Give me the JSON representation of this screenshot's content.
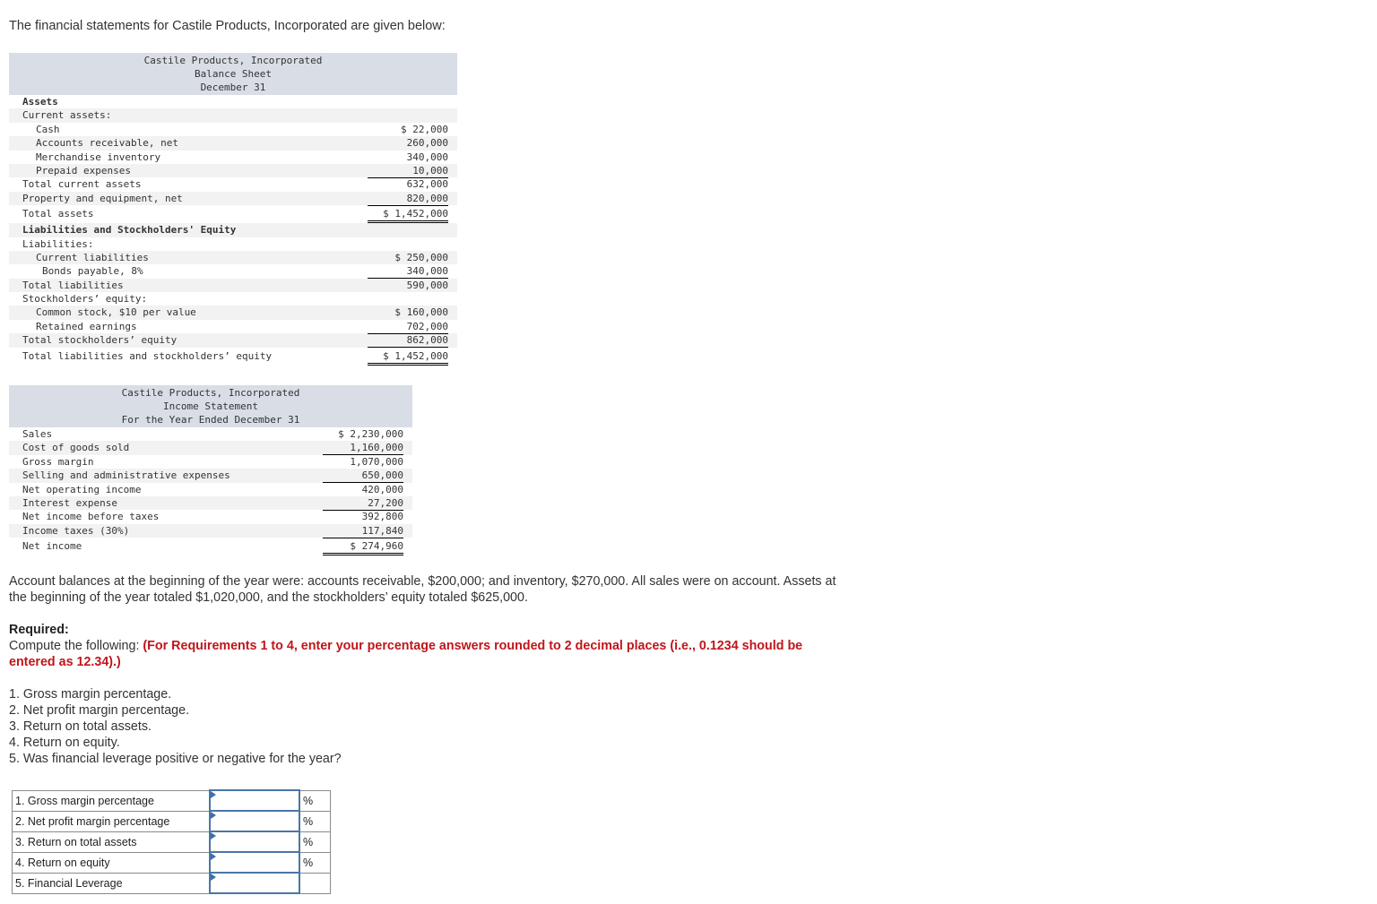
{
  "intro": "The financial statements for Castile Products, Incorporated are given below:",
  "balance_sheet": {
    "header": [
      "Castile Products, Incorporated",
      "Balance Sheet",
      "December 31"
    ],
    "rows": [
      {
        "label": "Assets",
        "value": "",
        "style": "b",
        "indent": 0,
        "line": ""
      },
      {
        "label": "Current assets:",
        "value": "",
        "indent": 0,
        "line": ""
      },
      {
        "label": "Cash",
        "value": "$ 22,000",
        "indent": 1,
        "line": ""
      },
      {
        "label": "Accounts receivable, net",
        "value": "260,000",
        "indent": 1,
        "line": ""
      },
      {
        "label": "Merchandise inventory",
        "value": "340,000",
        "indent": 1,
        "line": ""
      },
      {
        "label": "Prepaid expenses",
        "value": "10,000",
        "indent": 1,
        "line": "ul"
      },
      {
        "label": "Total current assets",
        "value": "632,000",
        "indent": 0,
        "line": ""
      },
      {
        "label": "Property and equipment, net",
        "value": "820,000",
        "indent": 0,
        "line": "ul"
      },
      {
        "label": "Total assets",
        "value": "$ 1,452,000",
        "indent": 0,
        "line": "dul",
        "tall": true
      },
      {
        "label": "Liabilities and Stockholders' Equity",
        "value": "",
        "style": "b",
        "indent": 0,
        "line": ""
      },
      {
        "label": "Liabilities:",
        "value": "",
        "indent": 0,
        "line": ""
      },
      {
        "label": "Current liabilities",
        "value": "$ 250,000",
        "indent": 1,
        "line": ""
      },
      {
        "label": "Bonds payable, 8%",
        "value": "340,000",
        "indent": 2,
        "line": "ul"
      },
      {
        "label": "Total liabilities",
        "value": "590,000",
        "indent": 0,
        "line": ""
      },
      {
        "label": "Stockholders’ equity:",
        "value": "",
        "indent": 0,
        "line": ""
      },
      {
        "label": "Common stock, $10 per value",
        "value": "$ 160,000",
        "indent": 1,
        "line": ""
      },
      {
        "label": "Retained earnings",
        "value": "702,000",
        "indent": 1,
        "line": "ul"
      },
      {
        "label": "Total stockholders’ equity",
        "value": "862,000",
        "indent": 0,
        "line": "ul"
      },
      {
        "label": "Total liabilities and stockholders’ equity",
        "value": "$ 1,452,000",
        "indent": 0,
        "line": "dul",
        "tall": true
      }
    ]
  },
  "income_statement": {
    "header": [
      "Castile Products, Incorporated",
      "Income Statement",
      "For the Year Ended December 31"
    ],
    "rows": [
      {
        "label": "Sales",
        "value": "$ 2,230,000",
        "indent": 0,
        "line": ""
      },
      {
        "label": "Cost of goods sold",
        "value": "1,160,000",
        "indent": 0,
        "line": "ul"
      },
      {
        "label": "Gross margin",
        "value": "1,070,000",
        "indent": 0,
        "line": ""
      },
      {
        "label": "Selling and administrative expenses",
        "value": "650,000",
        "indent": 0,
        "line": "ul"
      },
      {
        "label": "Net operating income",
        "value": "420,000",
        "indent": 0,
        "line": ""
      },
      {
        "label": "Interest expense",
        "value": "27,200",
        "indent": 0,
        "line": "ul"
      },
      {
        "label": "Net income before taxes",
        "value": "392,800",
        "indent": 0,
        "line": ""
      },
      {
        "label": "Income taxes (30%)",
        "value": "117,840",
        "indent": 0,
        "line": "ul"
      },
      {
        "label": "Net income",
        "value": "$ 274,960",
        "indent": 0,
        "line": "dul",
        "tall": true
      }
    ]
  },
  "context_text": "Account balances at the beginning of the year were: accounts receivable, $200,000; and inventory, $270,000. All sales were on account. Assets at the beginning of the year totaled $1,020,000, and the stockholders’ equity totaled $625,000.",
  "required": {
    "title": "Required:",
    "lead": "Compute the following: ",
    "instruction": "(For Requirements 1 to 4, enter your percentage answers rounded to 2 decimal places (i.e., 0.1234 should be entered as 12.34).)",
    "items": [
      "1. Gross margin percentage.",
      "2. Net profit margin percentage.",
      "3. Return on total assets.",
      "4. Return on equity.",
      "5. Was financial leverage positive or negative for the year?"
    ]
  },
  "answers": [
    {
      "label": "1. Gross margin percentage",
      "value": "",
      "unit": "%"
    },
    {
      "label": "2. Net profit margin percentage",
      "value": "",
      "unit": "%"
    },
    {
      "label": "3. Return on total assets",
      "value": "",
      "unit": "%"
    },
    {
      "label": "4. Return on equity",
      "value": "",
      "unit": "%"
    },
    {
      "label": "5. Financial Leverage",
      "value": "",
      "unit": ""
    }
  ]
}
